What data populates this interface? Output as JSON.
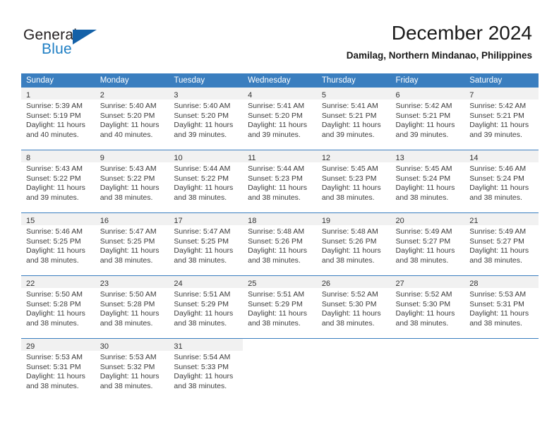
{
  "logo": {
    "word_primary": "General",
    "word_secondary": "Blue",
    "triangle_color": "#1461a8",
    "primary_color": "#231f20",
    "secondary_color": "#1f7fc4"
  },
  "header": {
    "month_title": "December 2024",
    "location": "Damilag, Northern Mindanao, Philippines"
  },
  "theme": {
    "header_blue": "#3a7ebf",
    "daynum_band": "#f1f1f1",
    "text": "#3c3c3c"
  },
  "calendar": {
    "day_names": [
      "Sunday",
      "Monday",
      "Tuesday",
      "Wednesday",
      "Thursday",
      "Friday",
      "Saturday"
    ],
    "weeks": [
      [
        {
          "day": "1",
          "lines": [
            "Sunrise: 5:39 AM",
            "Sunset: 5:19 PM",
            "Daylight: 11 hours",
            "and 40 minutes."
          ]
        },
        {
          "day": "2",
          "lines": [
            "Sunrise: 5:40 AM",
            "Sunset: 5:20 PM",
            "Daylight: 11 hours",
            "and 40 minutes."
          ]
        },
        {
          "day": "3",
          "lines": [
            "Sunrise: 5:40 AM",
            "Sunset: 5:20 PM",
            "Daylight: 11 hours",
            "and 39 minutes."
          ]
        },
        {
          "day": "4",
          "lines": [
            "Sunrise: 5:41 AM",
            "Sunset: 5:20 PM",
            "Daylight: 11 hours",
            "and 39 minutes."
          ]
        },
        {
          "day": "5",
          "lines": [
            "Sunrise: 5:41 AM",
            "Sunset: 5:21 PM",
            "Daylight: 11 hours",
            "and 39 minutes."
          ]
        },
        {
          "day": "6",
          "lines": [
            "Sunrise: 5:42 AM",
            "Sunset: 5:21 PM",
            "Daylight: 11 hours",
            "and 39 minutes."
          ]
        },
        {
          "day": "7",
          "lines": [
            "Sunrise: 5:42 AM",
            "Sunset: 5:21 PM",
            "Daylight: 11 hours",
            "and 39 minutes."
          ]
        }
      ],
      [
        {
          "day": "8",
          "lines": [
            "Sunrise: 5:43 AM",
            "Sunset: 5:22 PM",
            "Daylight: 11 hours",
            "and 39 minutes."
          ]
        },
        {
          "day": "9",
          "lines": [
            "Sunrise: 5:43 AM",
            "Sunset: 5:22 PM",
            "Daylight: 11 hours",
            "and 38 minutes."
          ]
        },
        {
          "day": "10",
          "lines": [
            "Sunrise: 5:44 AM",
            "Sunset: 5:22 PM",
            "Daylight: 11 hours",
            "and 38 minutes."
          ]
        },
        {
          "day": "11",
          "lines": [
            "Sunrise: 5:44 AM",
            "Sunset: 5:23 PM",
            "Daylight: 11 hours",
            "and 38 minutes."
          ]
        },
        {
          "day": "12",
          "lines": [
            "Sunrise: 5:45 AM",
            "Sunset: 5:23 PM",
            "Daylight: 11 hours",
            "and 38 minutes."
          ]
        },
        {
          "day": "13",
          "lines": [
            "Sunrise: 5:45 AM",
            "Sunset: 5:24 PM",
            "Daylight: 11 hours",
            "and 38 minutes."
          ]
        },
        {
          "day": "14",
          "lines": [
            "Sunrise: 5:46 AM",
            "Sunset: 5:24 PM",
            "Daylight: 11 hours",
            "and 38 minutes."
          ]
        }
      ],
      [
        {
          "day": "15",
          "lines": [
            "Sunrise: 5:46 AM",
            "Sunset: 5:25 PM",
            "Daylight: 11 hours",
            "and 38 minutes."
          ]
        },
        {
          "day": "16",
          "lines": [
            "Sunrise: 5:47 AM",
            "Sunset: 5:25 PM",
            "Daylight: 11 hours",
            "and 38 minutes."
          ]
        },
        {
          "day": "17",
          "lines": [
            "Sunrise: 5:47 AM",
            "Sunset: 5:25 PM",
            "Daylight: 11 hours",
            "and 38 minutes."
          ]
        },
        {
          "day": "18",
          "lines": [
            "Sunrise: 5:48 AM",
            "Sunset: 5:26 PM",
            "Daylight: 11 hours",
            "and 38 minutes."
          ]
        },
        {
          "day": "19",
          "lines": [
            "Sunrise: 5:48 AM",
            "Sunset: 5:26 PM",
            "Daylight: 11 hours",
            "and 38 minutes."
          ]
        },
        {
          "day": "20",
          "lines": [
            "Sunrise: 5:49 AM",
            "Sunset: 5:27 PM",
            "Daylight: 11 hours",
            "and 38 minutes."
          ]
        },
        {
          "day": "21",
          "lines": [
            "Sunrise: 5:49 AM",
            "Sunset: 5:27 PM",
            "Daylight: 11 hours",
            "and 38 minutes."
          ]
        }
      ],
      [
        {
          "day": "22",
          "lines": [
            "Sunrise: 5:50 AM",
            "Sunset: 5:28 PM",
            "Daylight: 11 hours",
            "and 38 minutes."
          ]
        },
        {
          "day": "23",
          "lines": [
            "Sunrise: 5:50 AM",
            "Sunset: 5:28 PM",
            "Daylight: 11 hours",
            "and 38 minutes."
          ]
        },
        {
          "day": "24",
          "lines": [
            "Sunrise: 5:51 AM",
            "Sunset: 5:29 PM",
            "Daylight: 11 hours",
            "and 38 minutes."
          ]
        },
        {
          "day": "25",
          "lines": [
            "Sunrise: 5:51 AM",
            "Sunset: 5:29 PM",
            "Daylight: 11 hours",
            "and 38 minutes."
          ]
        },
        {
          "day": "26",
          "lines": [
            "Sunrise: 5:52 AM",
            "Sunset: 5:30 PM",
            "Daylight: 11 hours",
            "and 38 minutes."
          ]
        },
        {
          "day": "27",
          "lines": [
            "Sunrise: 5:52 AM",
            "Sunset: 5:30 PM",
            "Daylight: 11 hours",
            "and 38 minutes."
          ]
        },
        {
          "day": "28",
          "lines": [
            "Sunrise: 5:53 AM",
            "Sunset: 5:31 PM",
            "Daylight: 11 hours",
            "and 38 minutes."
          ]
        }
      ],
      [
        {
          "day": "29",
          "lines": [
            "Sunrise: 5:53 AM",
            "Sunset: 5:31 PM",
            "Daylight: 11 hours",
            "and 38 minutes."
          ]
        },
        {
          "day": "30",
          "lines": [
            "Sunrise: 5:53 AM",
            "Sunset: 5:32 PM",
            "Daylight: 11 hours",
            "and 38 minutes."
          ]
        },
        {
          "day": "31",
          "lines": [
            "Sunrise: 5:54 AM",
            "Sunset: 5:33 PM",
            "Daylight: 11 hours",
            "and 38 minutes."
          ]
        },
        {
          "day": "",
          "lines": []
        },
        {
          "day": "",
          "lines": []
        },
        {
          "day": "",
          "lines": []
        },
        {
          "day": "",
          "lines": []
        }
      ]
    ]
  }
}
